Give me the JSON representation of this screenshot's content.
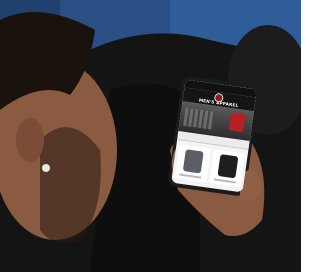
{
  "scene": {
    "colors": {
      "background_blue": "#2f5d9a",
      "shirt": "#141414",
      "skin": "#8a5b41",
      "hair": "#1a120d",
      "phone_frame": "#1b1b1d",
      "screen_bg": "#f4f4f4",
      "banner_accent": "#b82023"
    }
  },
  "phone": {
    "store_title": "MEN'S APPAREL",
    "icons": [
      "store-logo-icon",
      "tshirt-icon"
    ]
  }
}
